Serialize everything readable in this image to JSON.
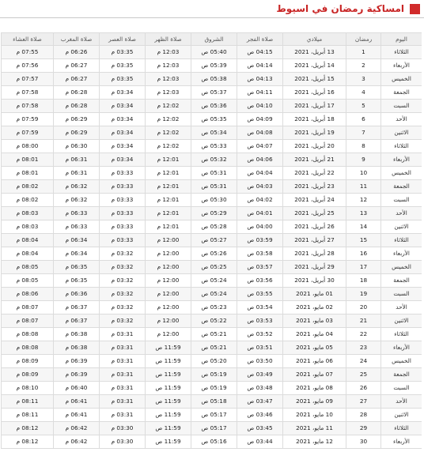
{
  "header": {
    "title": "امساكية رمضان في اسيوط"
  },
  "table": {
    "columns": [
      "اليوم",
      "رمضان",
      "ميلادي",
      "صلاة الفجر",
      "الشروق",
      "صلاة الظهر",
      "صلاة العصر",
      "صلاة المغرب",
      "صلاة العشاء"
    ],
    "rows": [
      [
        "الثلاثاء",
        "1",
        "13 أبريل، 2021",
        "04:15 ص",
        "05:40 ص",
        "12:03 م",
        "03:35 م",
        "06:26 م",
        "07:55 م"
      ],
      [
        "الأربعاء",
        "2",
        "14 أبريل، 2021",
        "04:14 ص",
        "05:39 ص",
        "12:03 م",
        "03:35 م",
        "06:27 م",
        "07:56 م"
      ],
      [
        "الخميس",
        "3",
        "15 أبريل، 2021",
        "04:13 ص",
        "05:38 ص",
        "12:03 م",
        "03:35 م",
        "06:27 م",
        "07:57 م"
      ],
      [
        "الجمعة",
        "4",
        "16 أبريل، 2021",
        "04:11 ص",
        "05:37 ص",
        "12:03 م",
        "03:34 م",
        "06:28 م",
        "07:58 م"
      ],
      [
        "السبت",
        "5",
        "17 أبريل، 2021",
        "04:10 ص",
        "05:36 ص",
        "12:02 م",
        "03:34 م",
        "06:28 م",
        "07:58 م"
      ],
      [
        "الأحد",
        "6",
        "18 أبريل، 2021",
        "04:09 ص",
        "05:35 ص",
        "12:02 م",
        "03:34 م",
        "06:29 م",
        "07:59 م"
      ],
      [
        "الاثنين",
        "7",
        "19 أبريل، 2021",
        "04:08 ص",
        "05:34 ص",
        "12:02 م",
        "03:34 م",
        "06:29 م",
        "07:59 م"
      ],
      [
        "الثلاثاء",
        "8",
        "20 أبريل، 2021",
        "04:07 ص",
        "05:33 ص",
        "12:02 م",
        "03:34 م",
        "06:30 م",
        "08:00 م"
      ],
      [
        "الأربعاء",
        "9",
        "21 أبريل، 2021",
        "04:06 ص",
        "05:32 ص",
        "12:01 م",
        "03:34 م",
        "06:31 م",
        "08:01 م"
      ],
      [
        "الخميس",
        "10",
        "22 أبريل، 2021",
        "04:04 ص",
        "05:31 ص",
        "12:01 م",
        "03:33 م",
        "06:31 م",
        "08:01 م"
      ],
      [
        "الجمعة",
        "11",
        "23 أبريل، 2021",
        "04:03 ص",
        "05:31 ص",
        "12:01 م",
        "03:33 م",
        "06:32 م",
        "08:02 م"
      ],
      [
        "السبت",
        "12",
        "24 أبريل، 2021",
        "04:02 ص",
        "05:30 ص",
        "12:01 م",
        "03:33 م",
        "06:32 م",
        "08:02 م"
      ],
      [
        "الأحد",
        "13",
        "25 أبريل، 2021",
        "04:01 ص",
        "05:29 ص",
        "12:01 م",
        "03:33 م",
        "06:33 م",
        "08:03 م"
      ],
      [
        "الاثنين",
        "14",
        "26 أبريل، 2021",
        "04:00 ص",
        "05:28 ص",
        "12:01 م",
        "03:33 م",
        "06:33 م",
        "08:03 م"
      ],
      [
        "الثلاثاء",
        "15",
        "27 أبريل، 2021",
        "03:59 ص",
        "05:27 ص",
        "12:00 م",
        "03:33 م",
        "06:34 م",
        "08:04 م"
      ],
      [
        "الأربعاء",
        "16",
        "28 أبريل، 2021",
        "03:58 ص",
        "05:26 ص",
        "12:00 م",
        "03:32 م",
        "06:34 م",
        "08:04 م"
      ],
      [
        "الخميس",
        "17",
        "29 أبريل، 2021",
        "03:57 ص",
        "05:25 ص",
        "12:00 م",
        "03:32 م",
        "06:35 م",
        "08:05 م"
      ],
      [
        "الجمعة",
        "18",
        "30 أبريل، 2021",
        "03:56 ص",
        "05:24 ص",
        "12:00 م",
        "03:32 م",
        "06:35 م",
        "08:05 م"
      ],
      [
        "السبت",
        "19",
        "01 مايو، 2021",
        "03:55 ص",
        "05:24 ص",
        "12:00 م",
        "03:32 م",
        "06:36 م",
        "08:06 م"
      ],
      [
        "الأحد",
        "20",
        "02 مايو، 2021",
        "03:54 ص",
        "05:23 ص",
        "12:00 م",
        "03:32 م",
        "06:37 م",
        "08:07 م"
      ],
      [
        "الاثنين",
        "21",
        "03 مايو، 2021",
        "03:53 ص",
        "05:22 ص",
        "12:00 م",
        "03:32 م",
        "06:37 م",
        "08:07 م"
      ],
      [
        "الثلاثاء",
        "22",
        "04 مايو، 2021",
        "03:52 ص",
        "05:21 ص",
        "12:00 م",
        "03:31 م",
        "06:38 م",
        "08:08 م"
      ],
      [
        "الأربعاء",
        "23",
        "05 مايو، 2021",
        "03:51 ص",
        "05:21 ص",
        "11:59 ص",
        "03:31 م",
        "06:38 م",
        "08:08 م"
      ],
      [
        "الخميس",
        "24",
        "06 مايو، 2021",
        "03:50 ص",
        "05:20 ص",
        "11:59 ص",
        "03:31 م",
        "06:39 م",
        "08:09 م"
      ],
      [
        "الجمعة",
        "25",
        "07 مايو، 2021",
        "03:49 ص",
        "05:19 ص",
        "11:59 ص",
        "03:31 م",
        "06:39 م",
        "08:09 م"
      ],
      [
        "السبت",
        "26",
        "08 مايو، 2021",
        "03:48 ص",
        "05:19 ص",
        "11:59 ص",
        "03:31 م",
        "06:40 م",
        "08:10 م"
      ],
      [
        "الأحد",
        "27",
        "09 مايو، 2021",
        "03:47 ص",
        "05:18 ص",
        "11:59 ص",
        "03:31 م",
        "06:41 م",
        "08:11 م"
      ],
      [
        "الاثنين",
        "28",
        "10 مايو، 2021",
        "03:46 ص",
        "05:17 ص",
        "11:59 ص",
        "03:31 م",
        "06:41 م",
        "08:11 م"
      ],
      [
        "الثلاثاء",
        "29",
        "11 مايو، 2021",
        "03:45 ص",
        "05:17 ص",
        "11:59 ص",
        "03:30 م",
        "06:42 م",
        "08:12 م"
      ],
      [
        "الأربعاء",
        "30",
        "12 مايو، 2021",
        "03:44 ص",
        "05:16 ص",
        "11:59 ص",
        "03:30 م",
        "06:42 م",
        "08:12 م"
      ]
    ]
  }
}
